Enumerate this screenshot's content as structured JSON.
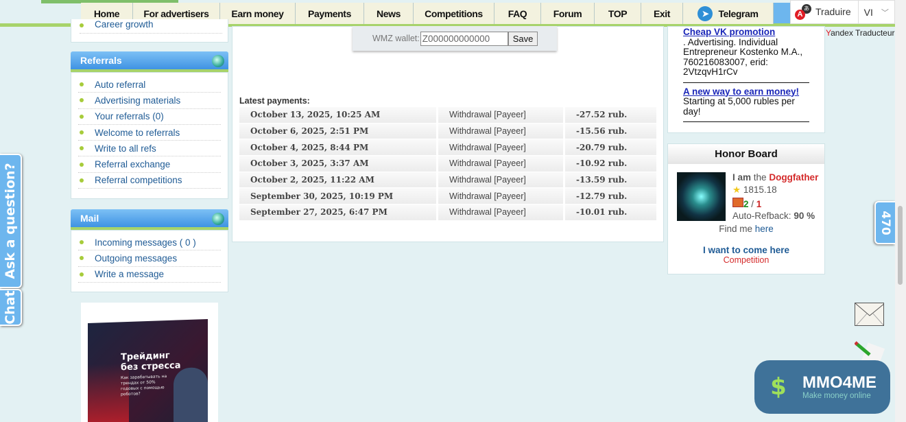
{
  "nav": {
    "items": [
      "Home",
      "For advertisers",
      "Earn money",
      "Payments",
      "News",
      "Competitions",
      "FAQ",
      "Forum",
      "TOP",
      "Exit",
      "Telegram"
    ]
  },
  "translate": {
    "label": "Traduire",
    "lang": "VI",
    "provider_y": "Y",
    "provider_rest": "andex Traducteur"
  },
  "left": {
    "partial_item": "Career growth",
    "referrals": {
      "title": "Referrals",
      "items": [
        "Auto referral",
        "Advertising materials",
        "Your referrals (0)",
        "Welcome to referrals",
        "Write to all refs",
        "Referral exchange",
        "Referral competitions"
      ]
    },
    "mail": {
      "title": "Mail",
      "items": [
        "Incoming messages ( 0 )",
        "Outgoing messages",
        "Write a message"
      ]
    },
    "ad": {
      "title_line1": "Трейдинг",
      "title_line2": "без стресса",
      "subtitle": "Как зарабатывать на трендах от 50% годовых с помощью роботов?"
    }
  },
  "wallet": {
    "label": "WMZ wallet:",
    "value": "Z000000000000",
    "save": "Save"
  },
  "payments": {
    "label": "Latest payments:",
    "rows": [
      {
        "date": "October 13, 2025, 10:25 AM",
        "type": "Withdrawal [Payeer]",
        "amount": "-27.52 rub."
      },
      {
        "date": "October 6, 2025, 2:51 PM",
        "type": "Withdrawal [Payeer]",
        "amount": "-15.56 rub."
      },
      {
        "date": "October 4, 2025, 8:44 PM",
        "type": "Withdrawal [Payeer]",
        "amount": "-20.79 rub."
      },
      {
        "date": "October 3, 2025, 3:37 AM",
        "type": "Withdrawal [Payeer]",
        "amount": "-10.92 rub."
      },
      {
        "date": "October 2, 2025, 11:22 AM",
        "type": "Withdrawal [Payeer]",
        "amount": "-13.59 rub."
      },
      {
        "date": "September 30, 2025, 10:19 PM",
        "type": "Withdrawal [Payeer]",
        "amount": "-12.79 rub."
      },
      {
        "date": "September 27, 2025, 6:47 PM",
        "type": "Withdrawal [Payeer]",
        "amount": "-10.01 rub."
      }
    ]
  },
  "ads": [
    {
      "link": "Cheap VK promotion",
      "text": ". Advertising. Individual Entrepreneur Kostenko M.A., 760216083007, erid: 2VtzqvH1rCv"
    },
    {
      "link": "A new way to earn money!",
      "text": "Starting at 5,000 rubles per day!"
    }
  ],
  "honor": {
    "title": "Honor Board",
    "iam": "I am",
    "the": "the",
    "name": "Doggfather",
    "rating": "1815.18",
    "refs_a": "2",
    "refs_sep": " / ",
    "refs_b": "1",
    "refback_label": "Auto-Refback:",
    "refback_value": "90 %",
    "find": "Find me",
    "here": "here",
    "want": "I want to come here",
    "competition": "Competition"
  },
  "side_tabs": {
    "ask": "Ask a question?",
    "chat": "Chat",
    "counter": "470"
  },
  "mmo": {
    "brand": "MMO4ME",
    "tagline": "Make money online"
  },
  "colors": {
    "bg": "#e3f1f3",
    "nav_bg": "#f3f2df",
    "accent_green": "#a7d36a",
    "header_blue": "#3f93e3",
    "link": "#1f5b95",
    "red": "#d42a2a"
  }
}
